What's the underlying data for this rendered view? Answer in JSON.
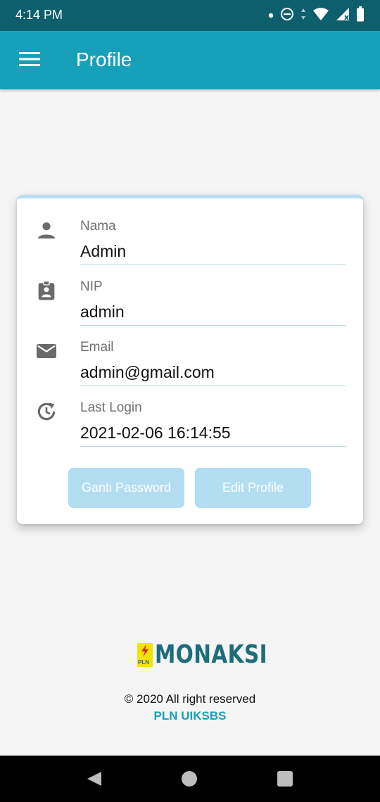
{
  "status_bar": {
    "time": "4:14 PM",
    "icons": [
      "notification-dot",
      "do-not-disturb-icon",
      "data-arrows-icon",
      "wifi-icon",
      "signal-icon",
      "battery-icon"
    ]
  },
  "app_bar": {
    "title": "Profile",
    "menu_icon": "hamburger-menu-icon"
  },
  "profile": {
    "fields": [
      {
        "label": "Nama",
        "value": "Admin",
        "icon": "person-icon"
      },
      {
        "label": "NIP",
        "value": "admin",
        "icon": "badge-icon"
      },
      {
        "label": "Email",
        "value": "admin@gmail.com",
        "icon": "mail-icon"
      },
      {
        "label": "Last Login",
        "value": "2021-02-06 16:14:55",
        "icon": "history-icon"
      }
    ],
    "buttons": {
      "change_password": "Ganti Password",
      "edit_profile": "Edit Profile"
    }
  },
  "footer": {
    "logo_text": "MONAKSI",
    "logo_sub": "PLN",
    "copyright": "© 2020 All right reserved",
    "company": "PLN UIKSBS"
  },
  "colors": {
    "status_bar": "#0d5f6e",
    "app_bar": "#17a0b9",
    "button_disabled": "#b3def2",
    "company_text": "#17a0b9"
  }
}
